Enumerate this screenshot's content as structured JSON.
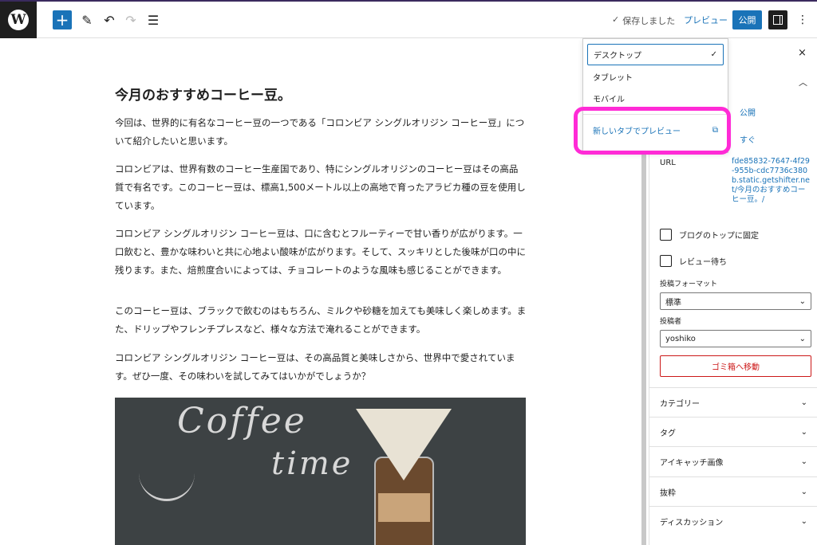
{
  "topbar": {
    "logo_letter": "W",
    "add_label": "+",
    "saved_check": "✓",
    "saved_label": "保存しました",
    "preview_label": "プレビュー",
    "publish_label": "公開",
    "more_label": "⋮"
  },
  "post": {
    "title": "今月のおすすめコーヒー豆。",
    "paragraphs": [
      "今回は、世界的に有名なコーヒー豆の一つである「コロンビア シングルオリジン コーヒー豆」について紹介したいと思います。",
      "コロンビアは、世界有数のコーヒー生産国であり、特にシングルオリジンのコーヒー豆はその高品質で有名です。このコーヒー豆は、標高1,500メートル以上の高地で育ったアラビカ種の豆を使用しています。",
      "コロンビア シングルオリジン コーヒー豆は、口に含むとフルーティーで甘い香りが広がります。一口飲むと、豊かな味わいと共に心地よい酸味が広がります。そして、スッキリとした後味が口の中に残ります。また、焙煎度合いによっては、チョコレートのような風味も感じることができます。",
      "このコーヒー豆は、ブラックで飲むのはもちろん、ミルクや砂糖を加えても美味しく楽しめます。また、ドリップやフレンチプレスなど、様々な方法で淹れることができます。",
      "コロンビア シングルオリジン コーヒー豆は、その高品質と美味しさから、世界中で愛されています。ぜひ一度、その味わいを試してみてはいかがでしょうか？"
    ],
    "image_text_1": "Coffee",
    "image_text_2": "time"
  },
  "preview_menu": {
    "desktop": "デスクトップ",
    "desktop_check": "✓",
    "tablet": "タブレット",
    "mobile": "モバイル",
    "new_tab": "新しいタブでプレビュー",
    "new_tab_icon": "⧉"
  },
  "sidebar": {
    "close": "×",
    "chevron_up": "︿",
    "visibility_value": "公開",
    "publish_value": "すぐ",
    "url_label": "URL",
    "url_value": "fde85832-7647-4f29-955b-cdc7736c380b.static.getshifter.net/今月のおすすめコーヒー豆。/",
    "sticky_label": "ブログのトップに固定",
    "pending_label": "レビュー待ち",
    "format_label": "投稿フォーマット",
    "format_value": "標準",
    "author_label": "投稿者",
    "author_value": "yoshiko",
    "trash_label": "ゴミ箱へ移動",
    "panels": [
      "カテゴリー",
      "タグ",
      "アイキャッチ画像",
      "抜粋",
      "ディスカッション"
    ]
  },
  "colors": {
    "accent": "#1a73b8",
    "highlight": "#ff2bd6",
    "danger": "#cc1818"
  }
}
